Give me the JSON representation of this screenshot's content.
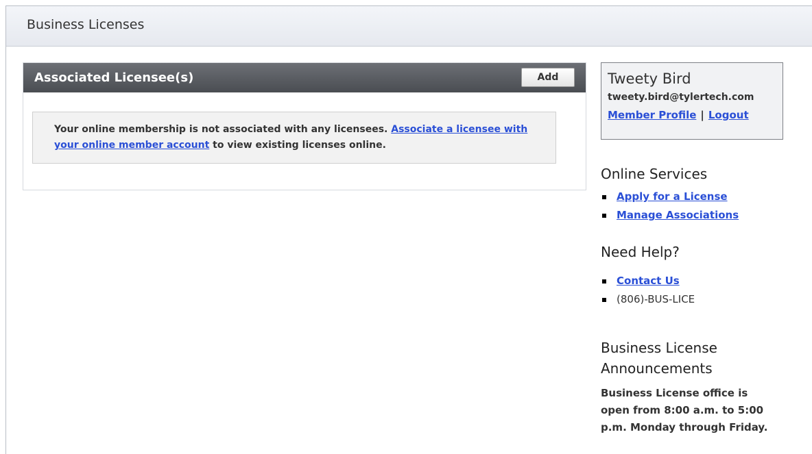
{
  "header": {
    "title": "Business Licenses"
  },
  "panel": {
    "title": "Associated Licensee(s)",
    "add_label": "Add",
    "notice": {
      "text_before": "Your online membership is not associated with any licensees.",
      "link_text": "Associate a licensee with your online member account",
      "text_after": "to view existing licenses online."
    }
  },
  "member": {
    "name": "Tweety Bird",
    "email": "tweety.bird@tylertech.com",
    "profile_link": "Member Profile",
    "separator": "|",
    "logout_link": "Logout"
  },
  "online_services": {
    "heading": "Online Services",
    "items": [
      {
        "label": "Apply for a License"
      },
      {
        "label": "Manage Associations"
      }
    ]
  },
  "help": {
    "heading": "Need Help?",
    "contact_link": "Contact Us",
    "phone": "(806)-BUS-LICE"
  },
  "announcements": {
    "heading": "Business License Announcements",
    "body": "Business License office is open from 8:00 a.m. to 5:00 p.m. Monday through Friday."
  },
  "colors": {
    "link": "#2a4fd6",
    "panel_header": "#55585d",
    "notice_bg": "#f2f2f2"
  }
}
